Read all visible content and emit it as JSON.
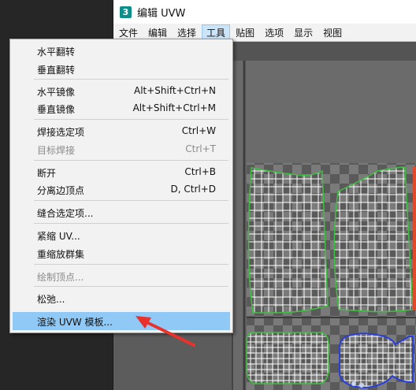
{
  "window": {
    "title": "编辑 UVW",
    "app_icon_label": "3"
  },
  "menubar": {
    "items": [
      {
        "label": "文件",
        "active": false
      },
      {
        "label": "编辑",
        "active": false
      },
      {
        "label": "选择",
        "active": false
      },
      {
        "label": "工具",
        "active": true
      },
      {
        "label": "贴图",
        "active": false
      },
      {
        "label": "选项",
        "active": false
      },
      {
        "label": "显示",
        "active": false
      },
      {
        "label": "视图",
        "active": false
      }
    ]
  },
  "tools_menu": {
    "items": [
      {
        "label": "水平翻转",
        "shortcut": "",
        "disabled": false
      },
      {
        "label": "垂直翻转",
        "shortcut": "",
        "disabled": false
      },
      {
        "label": "水平镜像",
        "shortcut": "Alt+Shift+Ctrl+N",
        "disabled": false
      },
      {
        "label": "垂直镜像",
        "shortcut": "Alt+Shift+Ctrl+M",
        "disabled": false
      },
      {
        "label": "焊接选定项",
        "shortcut": "Ctrl+W",
        "disabled": false
      },
      {
        "label": "目标焊接",
        "shortcut": "Ctrl+T",
        "disabled": true
      },
      {
        "label": "断开",
        "shortcut": "Ctrl+B",
        "disabled": false
      },
      {
        "label": "分离边顶点",
        "shortcut": "D, Ctrl+D",
        "disabled": false
      },
      {
        "label": "缝合选定项...",
        "shortcut": "",
        "disabled": false
      },
      {
        "label": "紧缩 UV...",
        "shortcut": "",
        "disabled": false
      },
      {
        "label": "重缩放群集",
        "shortcut": "",
        "disabled": false
      },
      {
        "label": "绘制顶点...",
        "shortcut": "",
        "disabled": true
      },
      {
        "label": "松弛...",
        "shortcut": "",
        "disabled": false
      },
      {
        "label": "渲染 UVW 模板...",
        "shortcut": "",
        "disabled": false,
        "highlighted": true
      }
    ]
  },
  "colors": {
    "highlight": "#90c8f6",
    "annotation_arrow": "#e8322b",
    "uv_border": "#3fbf3f",
    "uv_border_selected": "#2a3fd8",
    "uv_mesh": "#ffffff"
  }
}
